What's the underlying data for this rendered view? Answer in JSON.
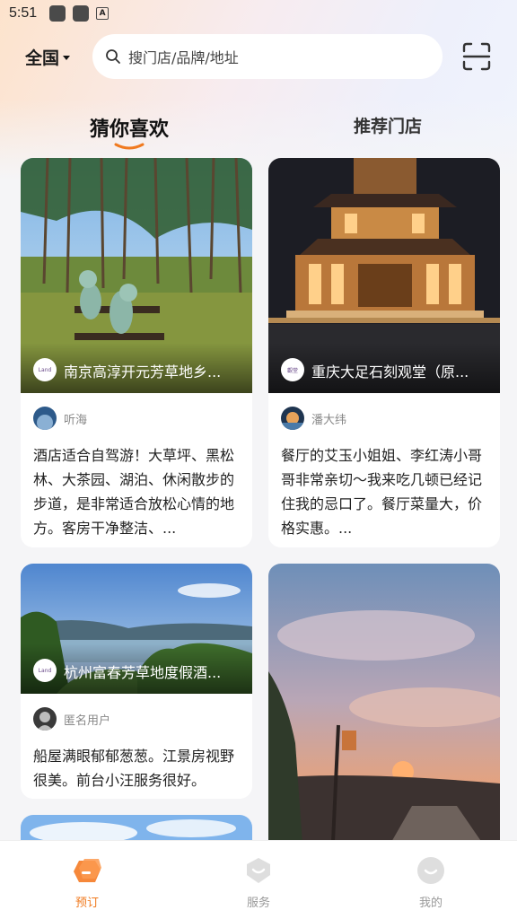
{
  "status_bar": {
    "time": "5:51"
  },
  "header": {
    "region": "全国",
    "search_placeholder": "搜门店/品牌/地址"
  },
  "tabs": [
    {
      "label": "猜你喜欢",
      "active": true
    },
    {
      "label": "推荐门店",
      "active": false
    }
  ],
  "cards": [
    {
      "title": "南京高淳开元芳草地乡...",
      "user": "听海",
      "review": "酒店适合自驾游！大草坪、黑松林、大茶园、湖泊、休闲散步的步道，是非常适合放松心情的地方。客房干净整洁、..."
    },
    {
      "title": "重庆大足石刻观堂（原...",
      "user": "潘大纬",
      "review": "餐厅的艾玉小姐姐、李红涛小哥哥非常亲切～我来吃几顿已经记住我的忌口了。餐厅菜量大，价格实惠。..."
    },
    {
      "title": "杭州富春芳草地度假酒...",
      "user": "匿名用户",
      "review": "船屋满眼郁郁葱葱。江景房视野很美。前台小汪服务很好。"
    },
    {
      "title": "",
      "user": "",
      "review": ""
    }
  ],
  "bottom_nav": [
    {
      "label": "预订",
      "icon": "booking-icon",
      "active": true
    },
    {
      "label": "服务",
      "icon": "service-icon",
      "active": false
    },
    {
      "label": "我的",
      "icon": "profile-icon",
      "active": false
    }
  ],
  "colors": {
    "accent": "#f07a1f",
    "background": "#f5f5f7"
  }
}
